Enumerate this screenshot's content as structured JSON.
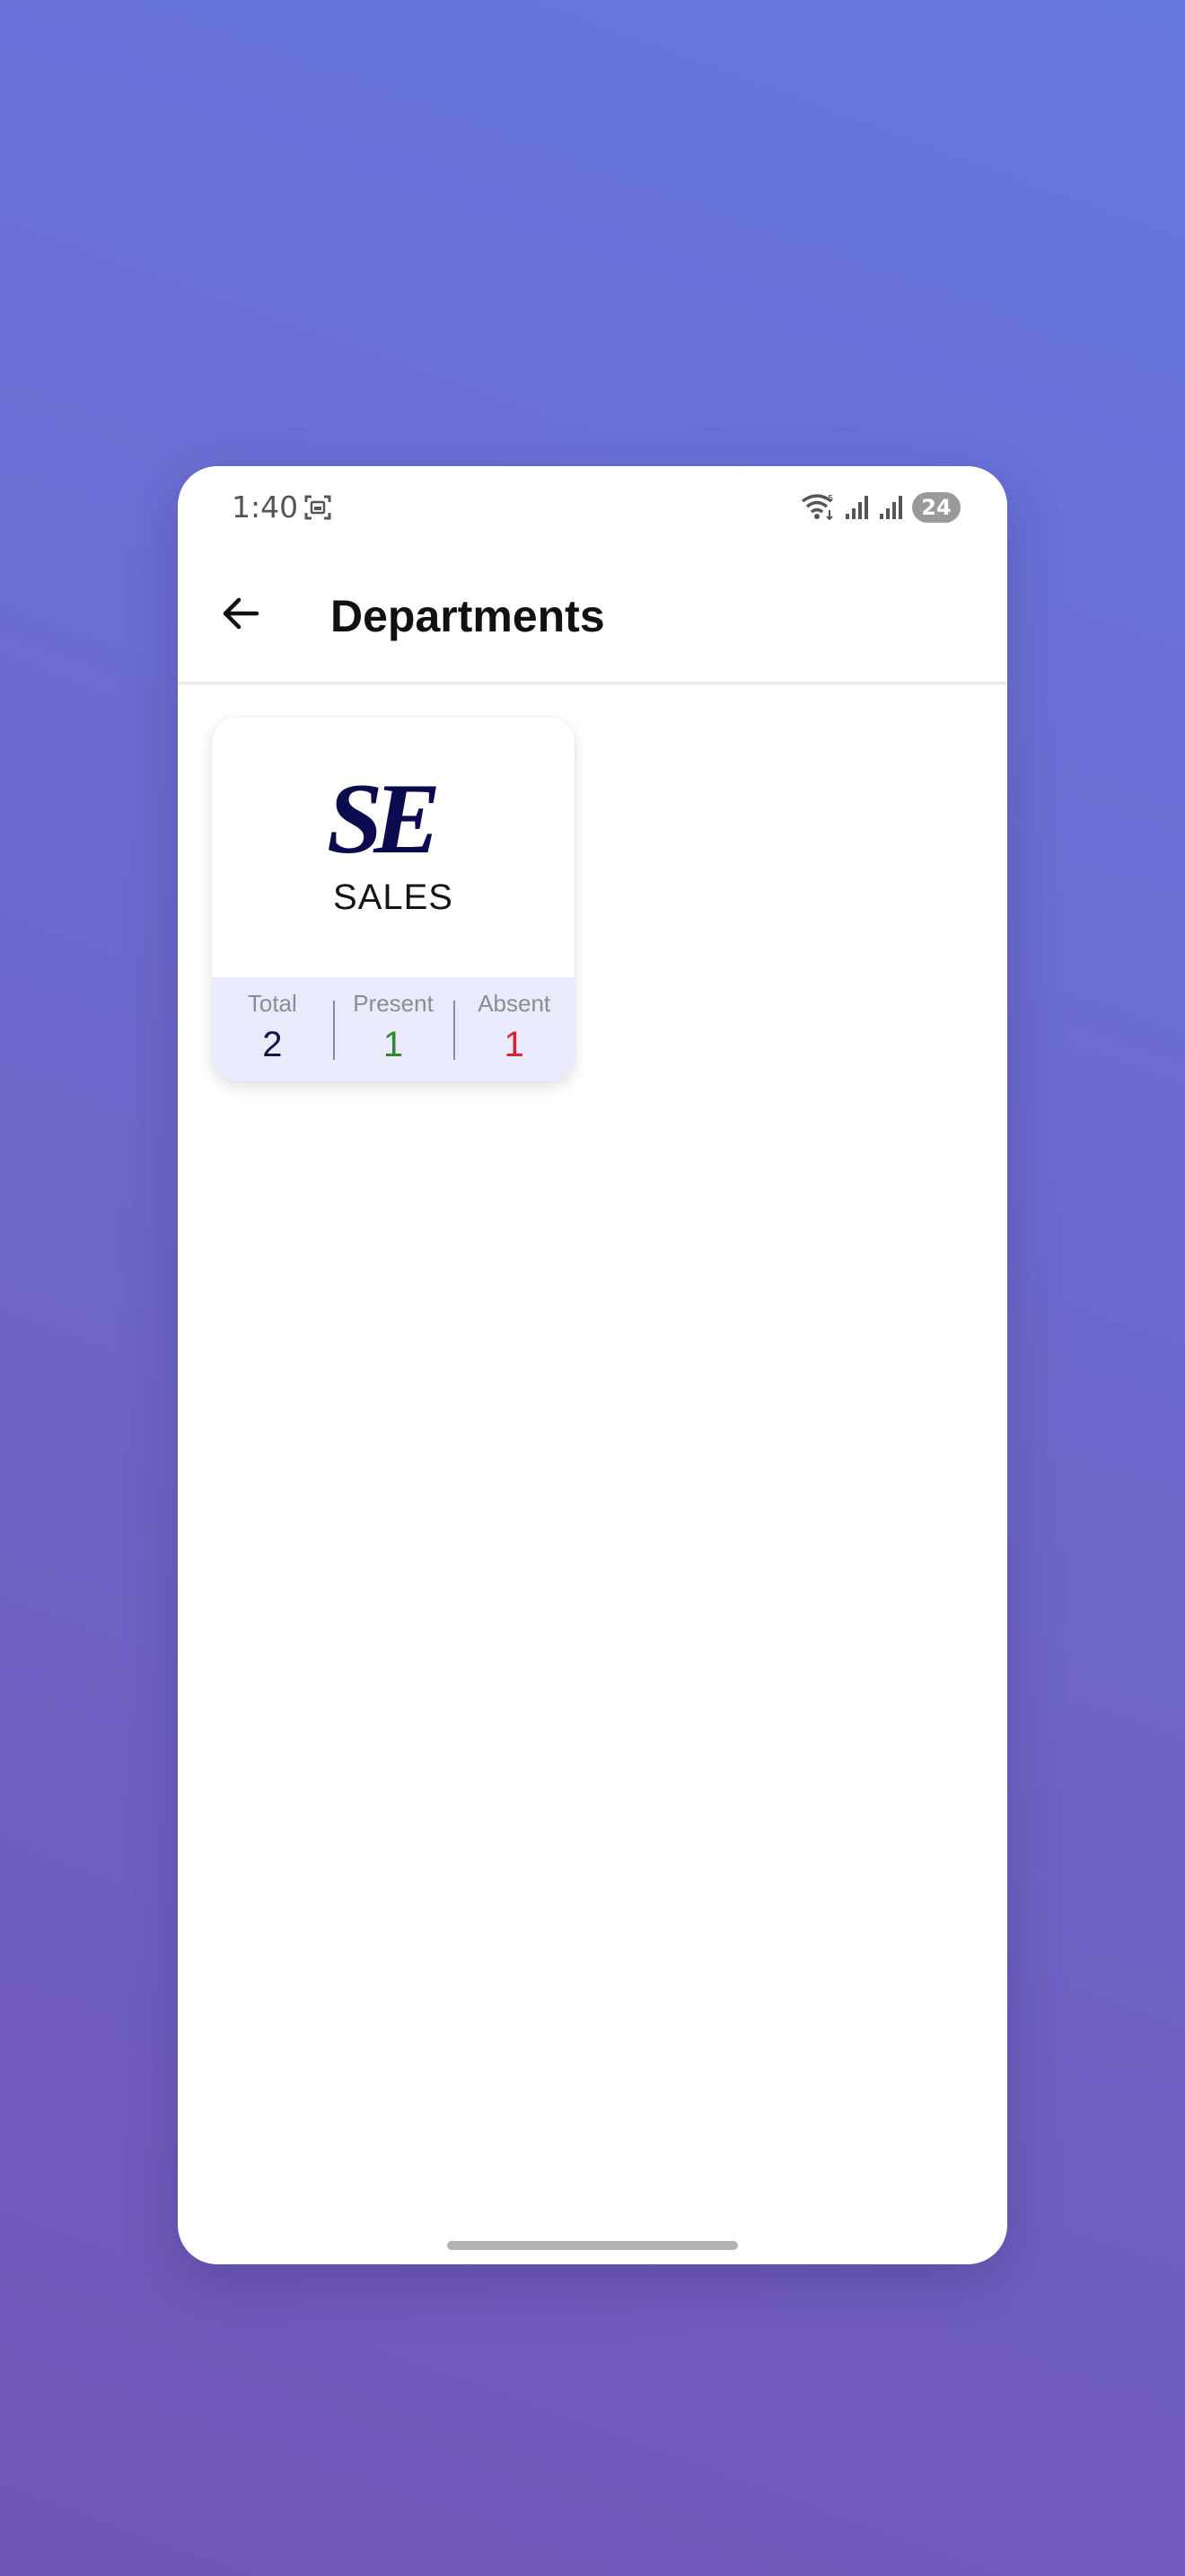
{
  "status_bar": {
    "time": "1:40",
    "battery": "24",
    "icons": [
      "screenshot-icon",
      "wifi-icon",
      "signal-icon",
      "signal-icon"
    ]
  },
  "app_bar": {
    "back_icon": "arrow-left-icon",
    "title": "Departments"
  },
  "departments": [
    {
      "logo": "SE",
      "name": "SALES",
      "stats": {
        "total_label": "Total",
        "total_value": "2",
        "present_label": "Present",
        "present_value": "1",
        "absent_label": "Absent",
        "absent_value": "1"
      }
    }
  ],
  "colors": {
    "logo": "#0c0a4f",
    "present": "#2f8a2f",
    "absent": "#d1262f",
    "stats_bg": "#e9eafb"
  }
}
